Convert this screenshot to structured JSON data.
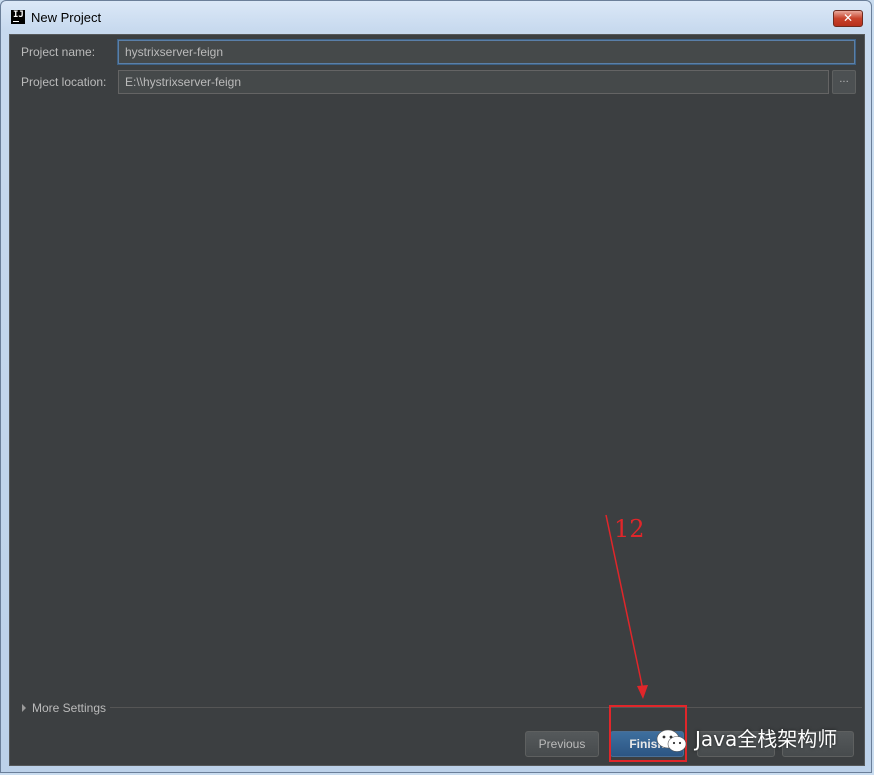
{
  "window": {
    "title": "New Project",
    "app_icon_text": "IJ",
    "close_glyph": "✕"
  },
  "form": {
    "project_name_label": "Project name:",
    "project_name_value": "hystrixserver-feign",
    "project_location_label": "Project location:",
    "project_location_value": "E:\\\\hystrixserver-feign",
    "browse_label": "..."
  },
  "more_settings": {
    "label": "More Settings"
  },
  "buttons": {
    "previous": "Previous",
    "finish": "Finish"
  },
  "annotation": {
    "step_number": "12",
    "color": "#e0262a"
  },
  "watermark": {
    "text": "Java全栈架构师",
    "icon": "wechat-icon"
  },
  "colors": {
    "dialog_bg": "#3c3f41",
    "text": "#bbbbbb",
    "default_button": "#2c5583"
  }
}
